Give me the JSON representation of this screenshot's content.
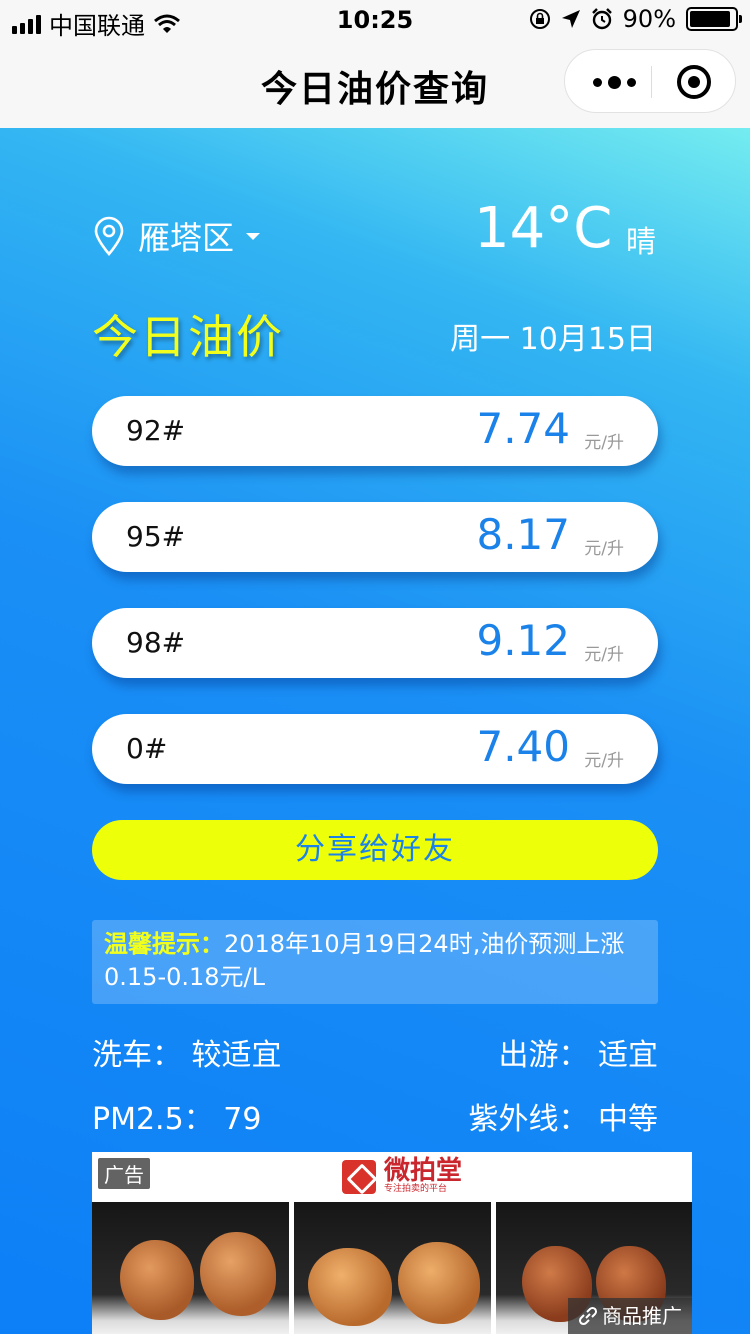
{
  "status_bar": {
    "carrier": "中国联通",
    "time": "10:25",
    "battery": "90%",
    "battery_level": 0.9
  },
  "nav": {
    "title": "今日油价查询"
  },
  "location": {
    "district": "雁塔区"
  },
  "weather": {
    "temperature": "14°C",
    "condition": "晴"
  },
  "header": {
    "title": "今日油价",
    "date": "周一 10月15日"
  },
  "prices": [
    {
      "grade": "92#",
      "value": "7.74",
      "unit": "元/升"
    },
    {
      "grade": "95#",
      "value": "8.17",
      "unit": "元/升"
    },
    {
      "grade": "98#",
      "value": "9.12",
      "unit": "元/升"
    },
    {
      "grade": "0#",
      "value": "7.40",
      "unit": "元/升"
    }
  ],
  "share_label": "分享给好友",
  "tip": {
    "label": "温馨提示：",
    "text": "2018年10月19日24时,油价预测上涨0.15-0.18元/L"
  },
  "indices": {
    "car_wash": {
      "label": "洗车：",
      "value": "较适宜"
    },
    "travel": {
      "label": "出游：",
      "value": "适宜"
    },
    "pm25": {
      "label": "PM2.5：",
      "value": "79"
    },
    "uv": {
      "label": "紫外线：",
      "value": "中等"
    }
  },
  "ad": {
    "badge": "广告",
    "brand": "微拍堂",
    "tagline": "专注拍卖的平台",
    "promo": "商品推广"
  },
  "colors": {
    "accent": "#1a82e8",
    "highlight": "#f2ff1c",
    "button": "#eeff0a"
  }
}
